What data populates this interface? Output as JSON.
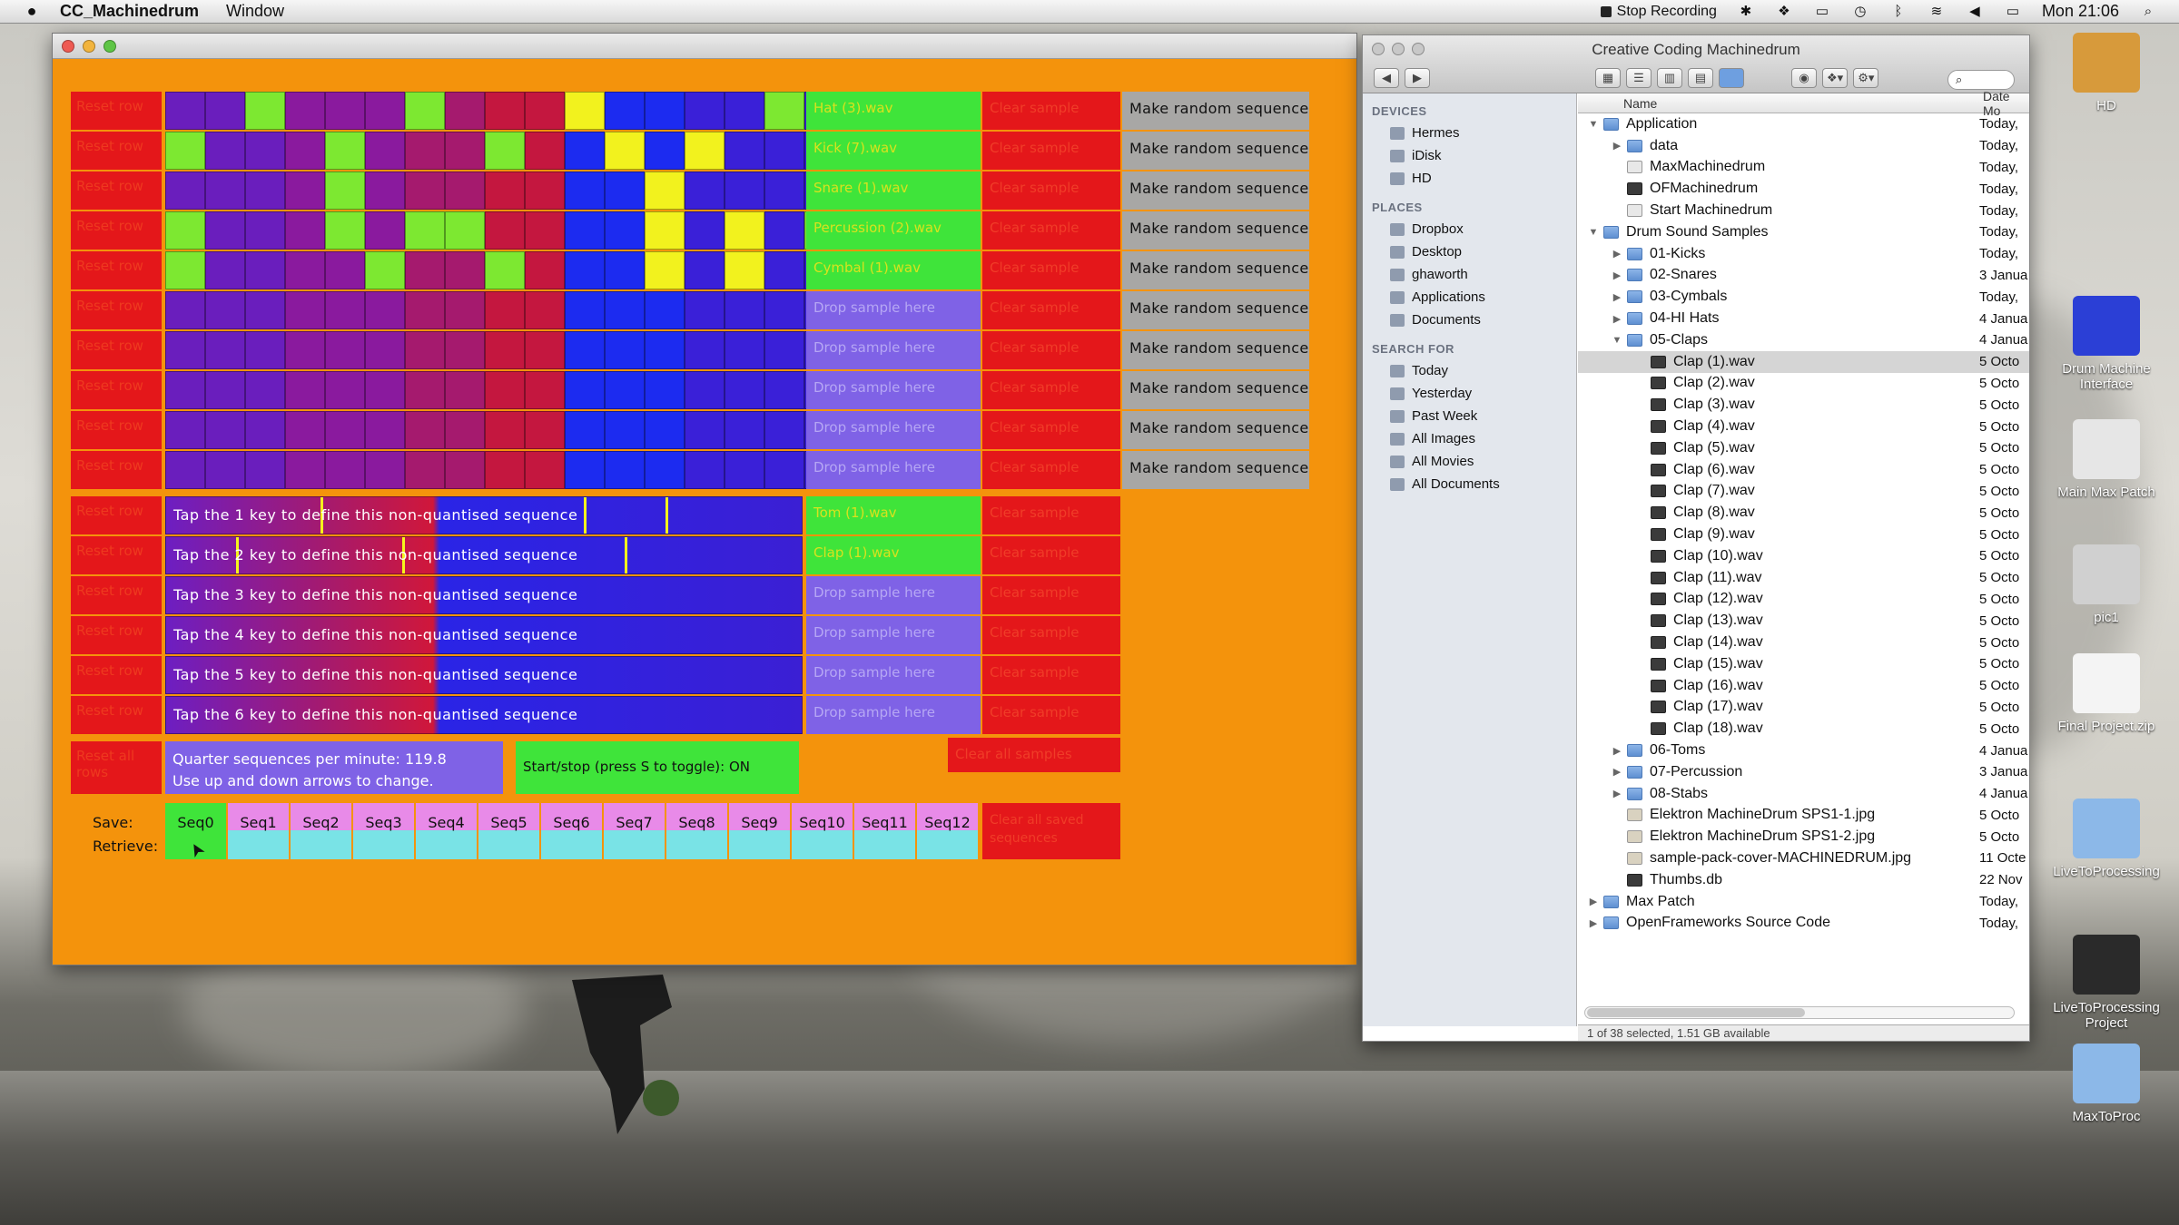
{
  "menubar": {
    "apple": "",
    "app": "CC_Machinedrum",
    "menu": "Window",
    "stop_recording": "Stop Recording",
    "clock": "Mon 21:06"
  },
  "app": {
    "reset_label": "Reset row",
    "grid_rows": [
      {
        "cells": "PPGPPPGPPPYBBBBGB",
        "sample": "Hat (3).wav",
        "loaded": true
      },
      {
        "cells": "GPPPGPPPGPBYBYBBB",
        "sample": "Kick (7).wav",
        "loaded": true
      },
      {
        "cells": "PPPPGPPPPPBBYBBBB",
        "sample": "Snare (1).wav",
        "loaded": true
      },
      {
        "cells": "GPPPGPGGPPBBYBYBG",
        "sample": "Percussion (2).wav",
        "loaded": true
      },
      {
        "cells": "GPPPPGPPGPBBYBYBB",
        "sample": "Cymbal (1).wav",
        "loaded": true
      },
      {
        "cells": "PPPPPPPPPPBBBBBBB",
        "sample": "Drop sample here",
        "loaded": false
      },
      {
        "cells": "PPPPPPPPPPBBBBBBB",
        "sample": "Drop sample here",
        "loaded": false
      },
      {
        "cells": "PPPPPPPPPPBBBBBBB",
        "sample": "Drop sample here",
        "loaded": false
      },
      {
        "cells": "PPPPPPPPPPBBBBBBB",
        "sample": "Drop sample here",
        "loaded": false
      },
      {
        "cells": "PPPPPPPPPPBBBBBBB",
        "sample": "Drop sample here",
        "loaded": false
      }
    ],
    "clear_sample": "Clear sample",
    "make_random": "Make random sequence",
    "nq_rows": [
      {
        "text": "Tap the 1 key to define this non-quantised sequence",
        "sample": "Tom (1).wav",
        "loaded": true
      },
      {
        "text": "Tap the 2 key to define this non-quantised sequence",
        "sample": "Clap (1).wav",
        "loaded": true
      },
      {
        "text": "Tap the 3 key to define this non-quantised sequence",
        "sample": "Drop sample here",
        "loaded": false
      },
      {
        "text": "Tap the 4 key to define this non-quantised sequence",
        "sample": "Drop sample here",
        "loaded": false
      },
      {
        "text": "Tap the 5 key to define this non-quantised sequence",
        "sample": "Drop sample here",
        "loaded": false
      },
      {
        "text": "Tap the 6 key to define this non-quantised sequence",
        "sample": "Drop sample here",
        "loaded": false
      }
    ],
    "reset_all": "Reset all rows",
    "tempo_line1": "Quarter sequences per minute: 119.8",
    "tempo_line2": "Use up and down arrows to change.",
    "startstop": "Start/stop (press S to toggle): ON",
    "clear_all_samples": "Clear all samples",
    "save_label": "Save:",
    "retrieve_label": "Retrieve:",
    "slots": [
      "Seq0",
      "Seq1",
      "Seq2",
      "Seq3",
      "Seq4",
      "Seq5",
      "Seq6",
      "Seq7",
      "Seq8",
      "Seq9",
      "Seq10",
      "Seq11",
      "Seq12"
    ],
    "clear_all_saved": "Clear all saved sequences",
    "colors": {
      "purple": "#8a1ea4",
      "green": "#7de831",
      "yellow": "#f2f21e",
      "blue": "#1c2bf0",
      "red": "#e4171a",
      "orange": "#f4930c"
    }
  },
  "finder": {
    "title": "Creative Coding Machinedrum",
    "search_icon": "search-icon",
    "sections": [
      {
        "header": "DEVICES",
        "items": [
          "Hermes",
          "iDisk",
          "HD"
        ]
      },
      {
        "header": "PLACES",
        "items": [
          "Dropbox",
          "Desktop",
          "ghaworth",
          "Applications",
          "Documents"
        ]
      },
      {
        "header": "SEARCH FOR",
        "items": [
          "Today",
          "Yesterday",
          "Past Week",
          "All Images",
          "All Movies",
          "All Documents"
        ]
      }
    ],
    "col_name": "Name",
    "col_date": "Date Mo",
    "rows": [
      {
        "n": "Application",
        "d": "Today,",
        "lvl": 0,
        "k": "folder",
        "t": "▼"
      },
      {
        "n": "data",
        "d": "Today,",
        "lvl": 1,
        "k": "folder",
        "t": "▶"
      },
      {
        "n": "MaxMachinedrum",
        "d": "Today,",
        "lvl": 1,
        "k": "app",
        "t": ""
      },
      {
        "n": "OFMachinedrum",
        "d": "Today,",
        "lvl": 1,
        "k": "doc",
        "t": ""
      },
      {
        "n": "Start Machinedrum",
        "d": "Today,",
        "lvl": 1,
        "k": "app",
        "t": ""
      },
      {
        "n": "Drum Sound Samples",
        "d": "Today,",
        "lvl": 0,
        "k": "folder",
        "t": "▼"
      },
      {
        "n": "01-Kicks",
        "d": "Today,",
        "lvl": 1,
        "k": "folder",
        "t": "▶"
      },
      {
        "n": "02-Snares",
        "d": "3 Janua",
        "lvl": 1,
        "k": "folder",
        "t": "▶"
      },
      {
        "n": "03-Cymbals",
        "d": "Today,",
        "lvl": 1,
        "k": "folder",
        "t": "▶"
      },
      {
        "n": "04-HI Hats",
        "d": "4 Janua",
        "lvl": 1,
        "k": "folder",
        "t": "▶"
      },
      {
        "n": "05-Claps",
        "d": "4 Janua",
        "lvl": 1,
        "k": "folder",
        "t": "▼"
      },
      {
        "n": "Clap (1).wav",
        "d": "5 Octo",
        "lvl": 2,
        "k": "doc",
        "t": "",
        "sel": true
      },
      {
        "n": "Clap (2).wav",
        "d": "5 Octo",
        "lvl": 2,
        "k": "doc",
        "t": ""
      },
      {
        "n": "Clap (3).wav",
        "d": "5 Octo",
        "lvl": 2,
        "k": "doc",
        "t": ""
      },
      {
        "n": "Clap (4).wav",
        "d": "5 Octo",
        "lvl": 2,
        "k": "doc",
        "t": ""
      },
      {
        "n": "Clap (5).wav",
        "d": "5 Octo",
        "lvl": 2,
        "k": "doc",
        "t": ""
      },
      {
        "n": "Clap (6).wav",
        "d": "5 Octo",
        "lvl": 2,
        "k": "doc",
        "t": ""
      },
      {
        "n": "Clap (7).wav",
        "d": "5 Octo",
        "lvl": 2,
        "k": "doc",
        "t": ""
      },
      {
        "n": "Clap (8).wav",
        "d": "5 Octo",
        "lvl": 2,
        "k": "doc",
        "t": ""
      },
      {
        "n": "Clap (9).wav",
        "d": "5 Octo",
        "lvl": 2,
        "k": "doc",
        "t": ""
      },
      {
        "n": "Clap (10).wav",
        "d": "5 Octo",
        "lvl": 2,
        "k": "doc",
        "t": ""
      },
      {
        "n": "Clap (11).wav",
        "d": "5 Octo",
        "lvl": 2,
        "k": "doc",
        "t": ""
      },
      {
        "n": "Clap (12).wav",
        "d": "5 Octo",
        "lvl": 2,
        "k": "doc",
        "t": ""
      },
      {
        "n": "Clap (13).wav",
        "d": "5 Octo",
        "lvl": 2,
        "k": "doc",
        "t": ""
      },
      {
        "n": "Clap (14).wav",
        "d": "5 Octo",
        "lvl": 2,
        "k": "doc",
        "t": ""
      },
      {
        "n": "Clap (15).wav",
        "d": "5 Octo",
        "lvl": 2,
        "k": "doc",
        "t": ""
      },
      {
        "n": "Clap (16).wav",
        "d": "5 Octo",
        "lvl": 2,
        "k": "doc",
        "t": ""
      },
      {
        "n": "Clap (17).wav",
        "d": "5 Octo",
        "lvl": 2,
        "k": "doc",
        "t": ""
      },
      {
        "n": "Clap (18).wav",
        "d": "5 Octo",
        "lvl": 2,
        "k": "doc",
        "t": ""
      },
      {
        "n": "06-Toms",
        "d": "4 Janua",
        "lvl": 1,
        "k": "folder",
        "t": "▶"
      },
      {
        "n": "07-Percussion",
        "d": "3 Janua",
        "lvl": 1,
        "k": "folder",
        "t": "▶"
      },
      {
        "n": "08-Stabs",
        "d": "4 Janua",
        "lvl": 1,
        "k": "folder",
        "t": "▶"
      },
      {
        "n": "Elektron MachineDrum SPS1-1.jpg",
        "d": "5 Octo",
        "lvl": 1,
        "k": "img",
        "t": ""
      },
      {
        "n": "Elektron MachineDrum SPS1-2.jpg",
        "d": "5 Octo",
        "lvl": 1,
        "k": "img",
        "t": ""
      },
      {
        "n": "sample-pack-cover-MACHINEDRUM.jpg",
        "d": "11 Octe",
        "lvl": 1,
        "k": "img",
        "t": ""
      },
      {
        "n": "Thumbs.db",
        "d": "22 Nov",
        "lvl": 1,
        "k": "doc",
        "t": ""
      },
      {
        "n": "Max Patch",
        "d": "Today,",
        "lvl": 0,
        "k": "folder",
        "t": "▶"
      },
      {
        "n": "OpenFrameworks Source Code",
        "d": "Today,",
        "lvl": 0,
        "k": "folder",
        "t": "▶"
      }
    ],
    "status": "1 of 38 selected, 1.51 GB available"
  },
  "desktop": [
    {
      "label": "HD",
      "color": "#d79a3b"
    },
    {
      "label": "Drum Machine Interface",
      "color": "#2b3fd6"
    },
    {
      "label": "Main Max Patch",
      "color": "#e6e6e6"
    },
    {
      "label": "pic1",
      "color": "#d0d0d0"
    },
    {
      "label": "Final Project.zip",
      "color": "#f4f4f4"
    },
    {
      "label": "LiveToProcessing",
      "color": "#8cb8e8"
    },
    {
      "label": "LiveToProcessing Project",
      "color": "#2a2a2a"
    },
    {
      "label": "MaxToProc",
      "color": "#8cb8e8"
    }
  ]
}
